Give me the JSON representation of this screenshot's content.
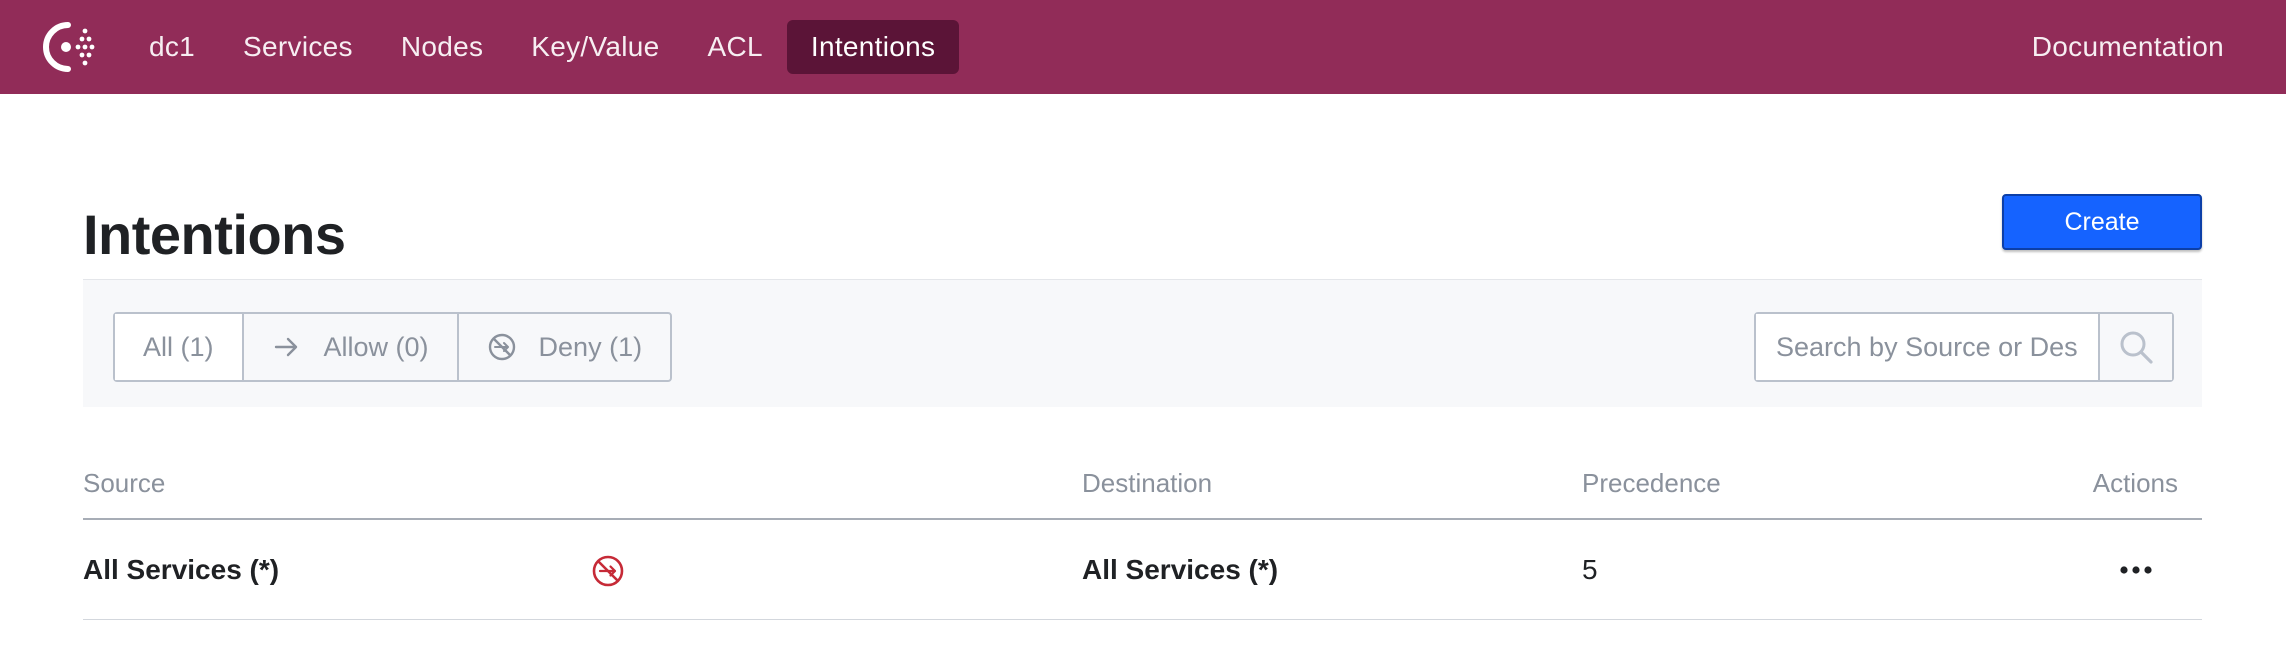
{
  "nav": {
    "datacenter": "dc1",
    "items": [
      {
        "label": "Services"
      },
      {
        "label": "Nodes"
      },
      {
        "label": "Key/Value"
      },
      {
        "label": "ACL"
      },
      {
        "label": "Intentions",
        "active": true
      }
    ],
    "documentation": "Documentation"
  },
  "page": {
    "title": "Intentions",
    "create_label": "Create"
  },
  "filters": {
    "all": "All (1)",
    "allow": "Allow (0)",
    "deny": "Deny (1)",
    "selected": "all"
  },
  "search": {
    "placeholder": "Search by Source or Destination",
    "value": ""
  },
  "table": {
    "columns": {
      "source": "Source",
      "destination": "Destination",
      "precedence": "Precedence",
      "actions": "Actions"
    },
    "rows": [
      {
        "source": "All Services (*)",
        "action": "deny",
        "destination": "All Services (*)",
        "precedence": "5",
        "actions_icon": "more-horizontal-icon"
      }
    ]
  },
  "colors": {
    "brand": "#912c58",
    "brand_active": "#5b1437",
    "primary_button": "#1563ff",
    "deny": "#c62a37"
  },
  "icons": {
    "logo": "consul-logo-icon",
    "allow": "arrow-right-icon",
    "deny": "deny-circle-icon",
    "search": "search-icon"
  }
}
